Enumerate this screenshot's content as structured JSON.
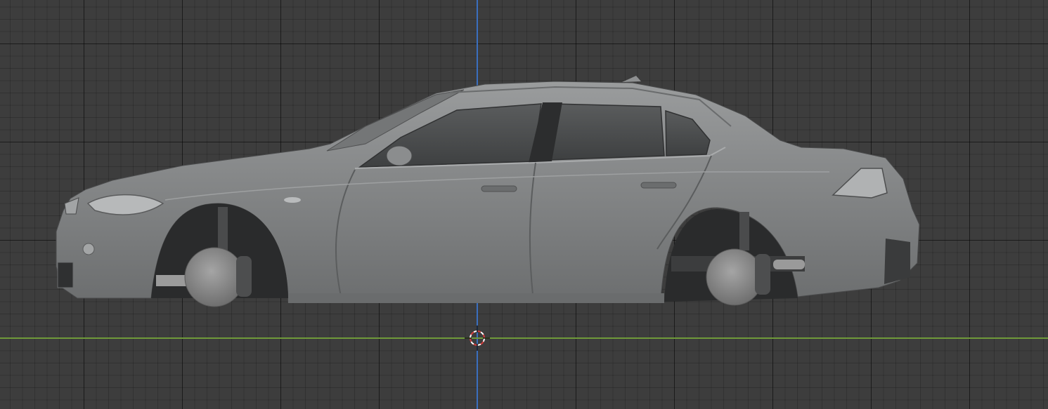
{
  "viewport": {
    "background_color": "#3d3d3d",
    "grid_color": "#2b2b2b",
    "axis_z_color": "#3a6fbf",
    "axis_y_color": "#6f9a3a",
    "body_color": "#8a8c8d",
    "cursor_icon": "3d-cursor-icon",
    "object": "sedan-car-body-mesh"
  }
}
